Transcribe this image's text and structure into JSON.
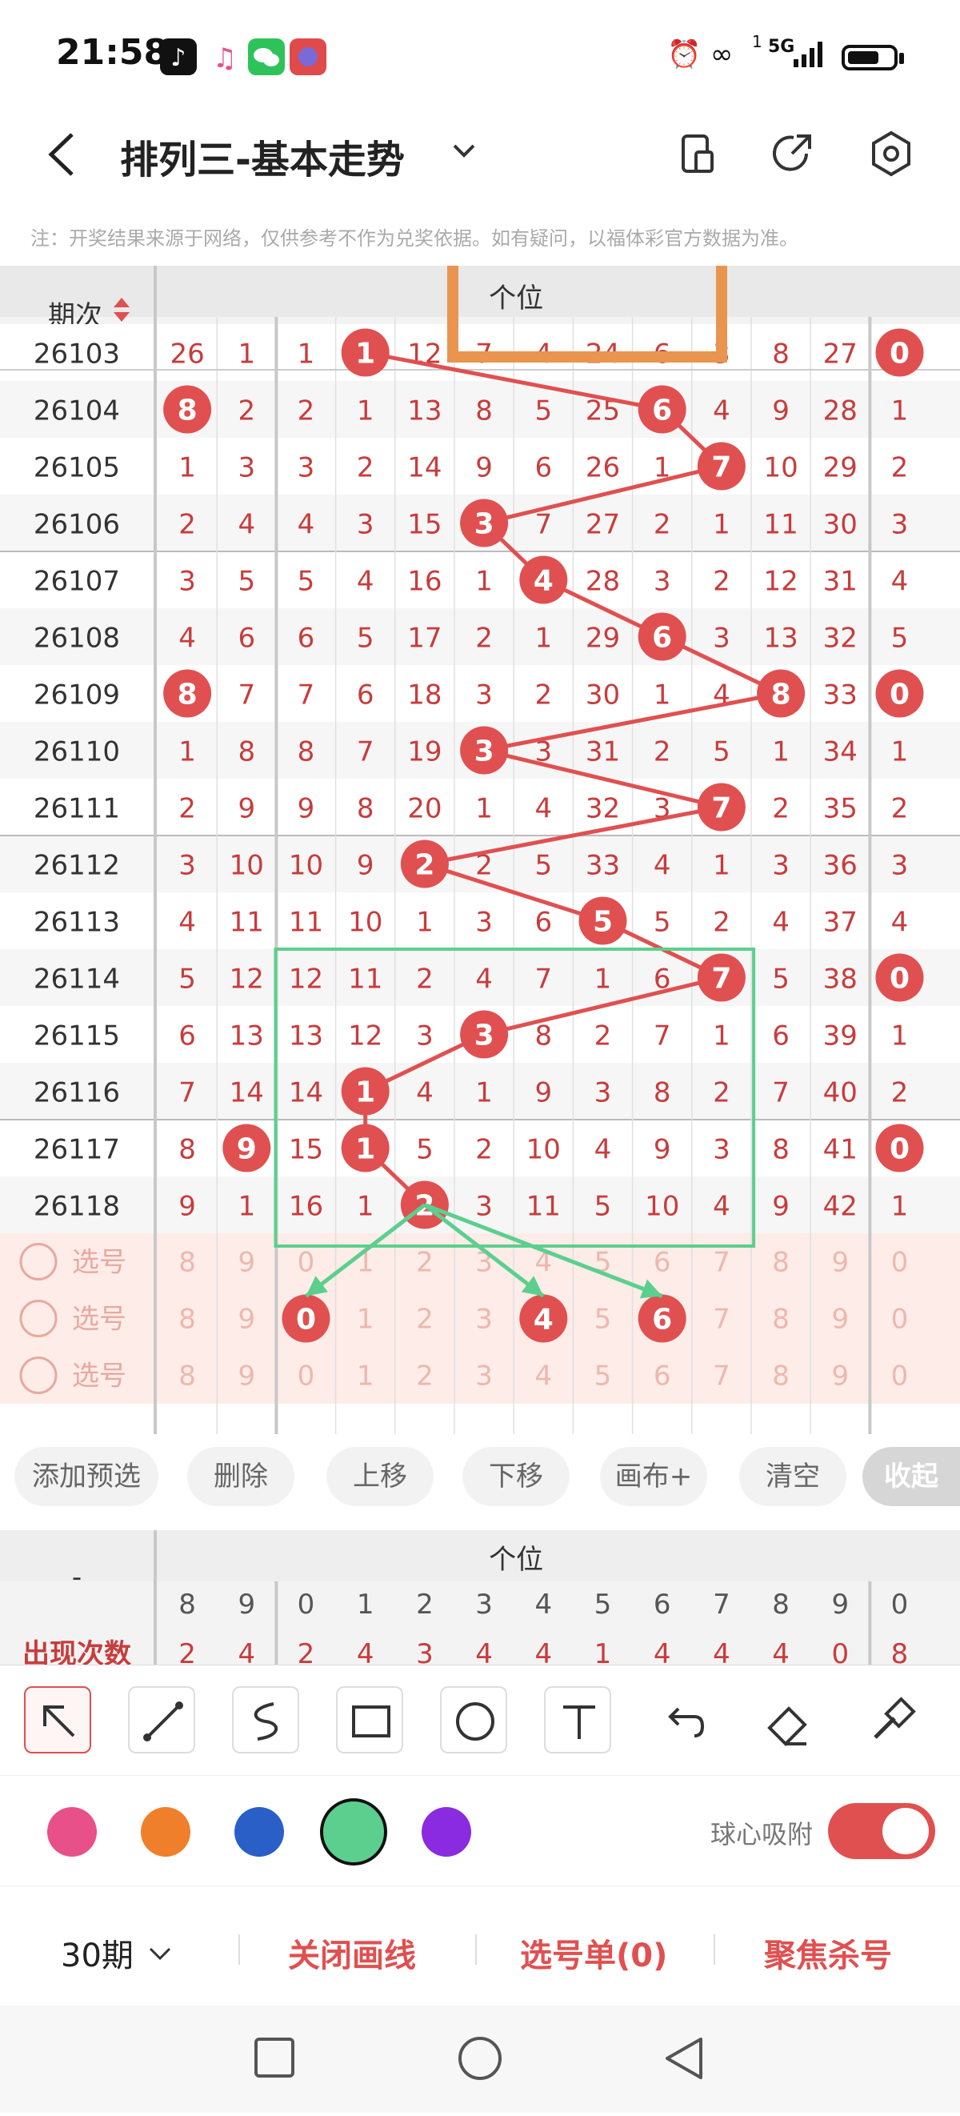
{
  "status": {
    "time": "21:58",
    "network": "5G",
    "sim_index": "1"
  },
  "header": {
    "title": "排列三-基本走势",
    "icons": [
      "back-arrow-icon",
      "chevron-down-icon",
      "phone-layout-icon",
      "share-icon",
      "settings-icon"
    ]
  },
  "notice": "注：开奖结果来源于网络，仅供参考不作为兑奖依据。如有疑问，以福体彩官方数据为准。",
  "table": {
    "period_header": "期次",
    "group_label": "个位",
    "columns": [
      "8",
      "9",
      "0",
      "1",
      "2",
      "3",
      "4",
      "5",
      "6",
      "7",
      "8",
      "9",
      "0"
    ],
    "periods": [
      "26103",
      "26104",
      "26105",
      "26106",
      "26107",
      "26108",
      "26109",
      "26110",
      "26111",
      "26112",
      "26113",
      "26114",
      "26115",
      "26116",
      "26117",
      "26118"
    ],
    "rows": [
      [
        "26",
        "1",
        "1",
        "1",
        "12",
        "7",
        "4",
        "24",
        "6",
        "3",
        "8",
        "27",
        "0"
      ],
      [
        "8",
        "2",
        "2",
        "1",
        "13",
        "8",
        "5",
        "25",
        "6",
        "4",
        "9",
        "28",
        "1"
      ],
      [
        "1",
        "3",
        "3",
        "2",
        "14",
        "9",
        "6",
        "26",
        "1",
        "7",
        "10",
        "29",
        "2"
      ],
      [
        "2",
        "4",
        "4",
        "3",
        "15",
        "3",
        "7",
        "27",
        "2",
        "1",
        "11",
        "30",
        "3"
      ],
      [
        "3",
        "5",
        "5",
        "4",
        "16",
        "1",
        "4",
        "28",
        "3",
        "2",
        "12",
        "31",
        "4"
      ],
      [
        "4",
        "6",
        "6",
        "5",
        "17",
        "2",
        "1",
        "29",
        "6",
        "3",
        "13",
        "32",
        "5"
      ],
      [
        "8",
        "7",
        "7",
        "6",
        "18",
        "3",
        "2",
        "30",
        "1",
        "4",
        "8",
        "33",
        "0"
      ],
      [
        "1",
        "8",
        "8",
        "7",
        "19",
        "3",
        "3",
        "31",
        "2",
        "5",
        "1",
        "34",
        "1"
      ],
      [
        "2",
        "9",
        "9",
        "8",
        "20",
        "1",
        "4",
        "32",
        "3",
        "7",
        "2",
        "35",
        "2"
      ],
      [
        "3",
        "10",
        "10",
        "9",
        "2",
        "2",
        "5",
        "33",
        "4",
        "1",
        "3",
        "36",
        "3"
      ],
      [
        "4",
        "11",
        "11",
        "10",
        "1",
        "3",
        "6",
        "5",
        "5",
        "2",
        "4",
        "37",
        "4"
      ],
      [
        "5",
        "12",
        "12",
        "11",
        "2",
        "4",
        "7",
        "1",
        "6",
        "7",
        "5",
        "38",
        "0"
      ],
      [
        "6",
        "13",
        "13",
        "12",
        "3",
        "3",
        "8",
        "2",
        "7",
        "1",
        "6",
        "39",
        "1"
      ],
      [
        "7",
        "14",
        "14",
        "1",
        "4",
        "1",
        "9",
        "3",
        "8",
        "2",
        "7",
        "40",
        "2"
      ],
      [
        "8",
        "9",
        "15",
        "1",
        "5",
        "2",
        "10",
        "4",
        "9",
        "3",
        "8",
        "41",
        "0"
      ],
      [
        "9",
        "1",
        "16",
        "1",
        "2",
        "3",
        "11",
        "5",
        "10",
        "4",
        "9",
        "42",
        "1"
      ]
    ],
    "hits": [
      [
        3,
        12
      ],
      [
        0,
        8
      ],
      [
        9
      ],
      [
        5
      ],
      [
        6
      ],
      [
        8
      ],
      [
        0,
        10,
        12
      ],
      [
        5
      ],
      [
        9
      ],
      [
        4
      ],
      [
        7
      ],
      [
        9,
        12
      ],
      [
        5
      ],
      [
        3
      ],
      [
        1,
        3,
        12
      ],
      [
        4
      ]
    ],
    "select_label": "选号",
    "select_rows": [
      [
        "8",
        "9",
        "0",
        "1",
        "2",
        "3",
        "4",
        "5",
        "6",
        "7",
        "8",
        "9",
        "0"
      ],
      [
        "8",
        "9",
        "0",
        "1",
        "2",
        "3",
        "4",
        "5",
        "6",
        "7",
        "8",
        "9",
        "0"
      ],
      [
        "8",
        "9",
        "0",
        "1",
        "2",
        "3",
        "4",
        "5",
        "6",
        "7",
        "8",
        "9",
        "0"
      ]
    ],
    "select_hits": [
      [],
      [
        2,
        6,
        8
      ],
      []
    ]
  },
  "buttons": [
    "添加预选",
    "删除",
    "上移",
    "下移",
    "画布+",
    "清空",
    "收起"
  ],
  "stats": {
    "left_label": "-",
    "group_label": "个位",
    "columns": [
      "8",
      "9",
      "0",
      "1",
      "2",
      "3",
      "4",
      "5",
      "6",
      "7",
      "8",
      "9",
      "0"
    ],
    "row_label": "出现次数",
    "row_values": [
      "2",
      "4",
      "2",
      "4",
      "3",
      "4",
      "4",
      "1",
      "4",
      "4",
      "4",
      "0",
      "8"
    ]
  },
  "toolbar": {
    "tools": [
      "select-arrow-icon",
      "line-icon",
      "freehand-icon",
      "rectangle-icon",
      "circle-icon",
      "text-icon",
      "undo-icon",
      "eraser-icon",
      "brush-icon"
    ]
  },
  "palette": {
    "colors": [
      "#e8508a",
      "#ef7f2a",
      "#2a5fc8",
      "#5ccf8e",
      "#8a2be2"
    ],
    "selected": "#5ccf8e",
    "snap_label": "球心吸附",
    "snap_on": true
  },
  "actions": {
    "periods": "30期",
    "close_lines": "关闭画线",
    "selection_list": "选号单(0)",
    "focus_kill": "聚焦杀号"
  },
  "accent": "#e05050",
  "annotation_colors": {
    "orange": "#e99550",
    "green": "#5ccf8e"
  }
}
